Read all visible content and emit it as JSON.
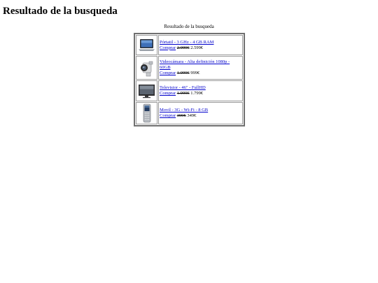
{
  "page": {
    "heading": "Resultado de la busqueda",
    "caption": "Resultado de la busqueda"
  },
  "results": [
    {
      "product": "Pórtatil - 3 GHz - 4 GB RAM",
      "buy_label": "Comprar",
      "old_price": "2.999€",
      "new_price": "2.599€",
      "icon": "laptop-icon"
    },
    {
      "product": "Videocámara - Alta definición 1080p - 60GB",
      "buy_label": "Comprar",
      "old_price": "1.099€",
      "new_price": "999€",
      "icon": "camcorder-icon"
    },
    {
      "product": "Televisior - 46\" - FullHD",
      "buy_label": "Comprar",
      "old_price": "1.999€",
      "new_price": "1.799€",
      "icon": "television-icon"
    },
    {
      "product": "Movil - 3G - Wi-Fi - 8 GB",
      "buy_label": "Comprar",
      "old_price": "399€",
      "new_price": "349€",
      "icon": "mobile-phone-icon"
    }
  ]
}
